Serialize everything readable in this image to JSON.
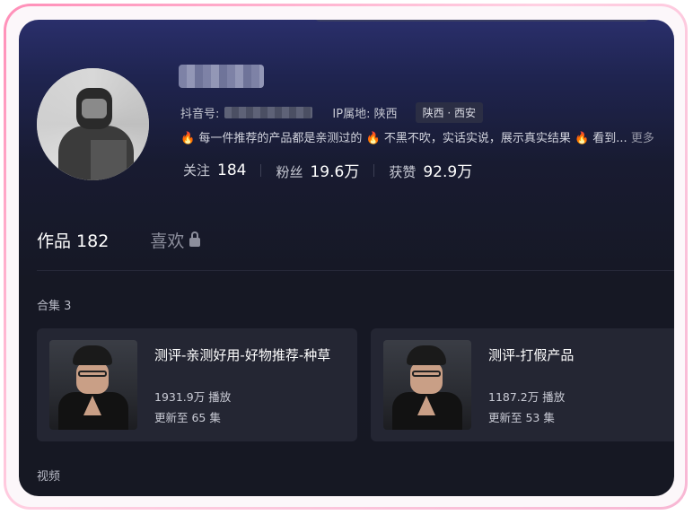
{
  "profile": {
    "douyin_id_label": "抖音号:",
    "ip_label": "IP属地: 陕西",
    "location_tag": "陕西 · 西安",
    "bio_parts": [
      "每一件推荐的产品都是亲测过的",
      "不黑不吹，实话实说，展示真实结果",
      "看到..."
    ],
    "bio_more": "更多",
    "stats": [
      {
        "label": "关注",
        "value": "184"
      },
      {
        "label": "粉丝",
        "value": "19.6万"
      },
      {
        "label": "获赞",
        "value": "92.9万"
      }
    ]
  },
  "tabs": {
    "works_label": "作品 182",
    "likes_label": "喜欢"
  },
  "collections": {
    "title": "合集 3",
    "items": [
      {
        "title": "测评-亲测好用-好物推荐-种草",
        "plays": "1931.9万 播放",
        "updated": "更新至 65 集"
      },
      {
        "title": "测评-打假产品",
        "plays": "1187.2万 播放",
        "updated": "更新至 53 集"
      }
    ]
  },
  "videos": {
    "title": "视频"
  },
  "colors": {
    "accent_fire": "#ff8a1f",
    "background": "#161823"
  }
}
